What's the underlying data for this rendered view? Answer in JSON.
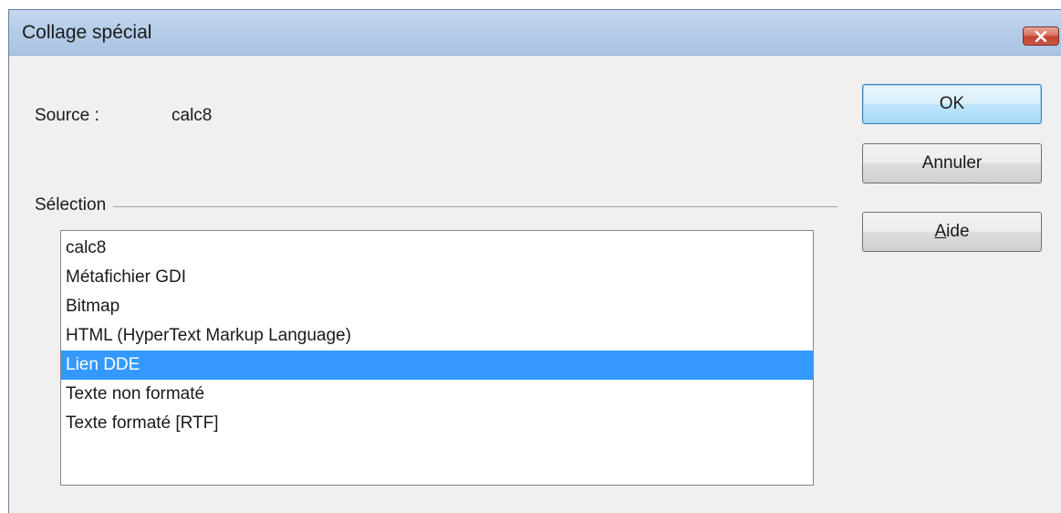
{
  "window": {
    "title": "Collage spécial",
    "close_icon": "close-icon"
  },
  "source": {
    "label": "Source :",
    "value": "calc8"
  },
  "selection": {
    "label": "Sélection",
    "items": [
      {
        "label": "calc8",
        "selected": false
      },
      {
        "label": "Métafichier GDI",
        "selected": false
      },
      {
        "label": "Bitmap",
        "selected": false
      },
      {
        "label": "HTML (HyperText Markup Language)",
        "selected": false
      },
      {
        "label": "Lien DDE",
        "selected": true
      },
      {
        "label": "Texte non formaté",
        "selected": false
      },
      {
        "label": "Texte formaté [RTF]",
        "selected": false
      }
    ]
  },
  "buttons": {
    "ok": "OK",
    "cancel": "Annuler",
    "help_mnemonic": "A",
    "help_rest": "ide"
  },
  "colors": {
    "selection_highlight": "#3399ff",
    "close_button": "#c1432f"
  }
}
